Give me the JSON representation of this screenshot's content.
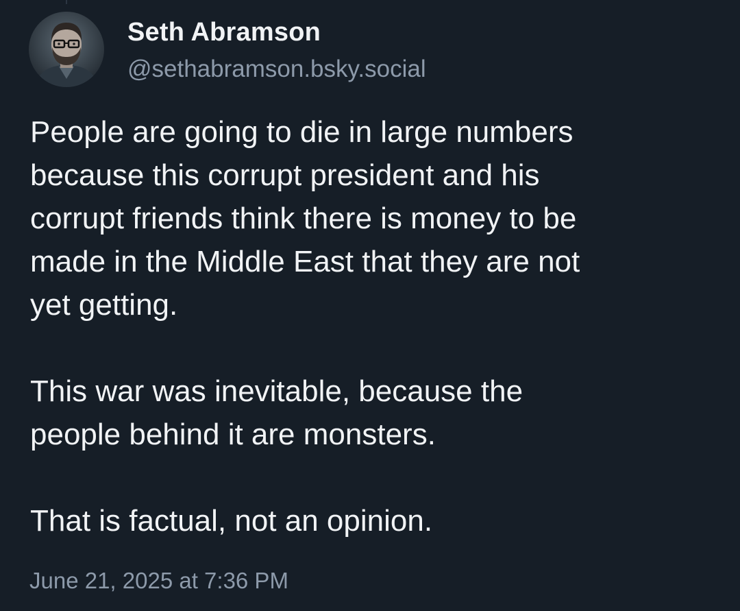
{
  "author": {
    "display_name": "Seth Abramson",
    "handle": "@sethabramson.bsky.social",
    "avatar_icon": "profile-photo"
  },
  "post": {
    "paragraphs": [
      [
        "People are going to die in large numbers",
        "because this corrupt president and his",
        "corrupt friends think there is money to be",
        "made in the Middle East that they are not",
        "yet getting."
      ],
      [
        "This war was inevitable, because the",
        "people behind it are monsters."
      ],
      [
        "That is factual, not an opinion."
      ]
    ],
    "timestamp": "June 21, 2025 at 7:36 PM"
  },
  "colors": {
    "background": "#161e27",
    "text": "#f1f3f5",
    "muted": "#8d9aaa"
  }
}
